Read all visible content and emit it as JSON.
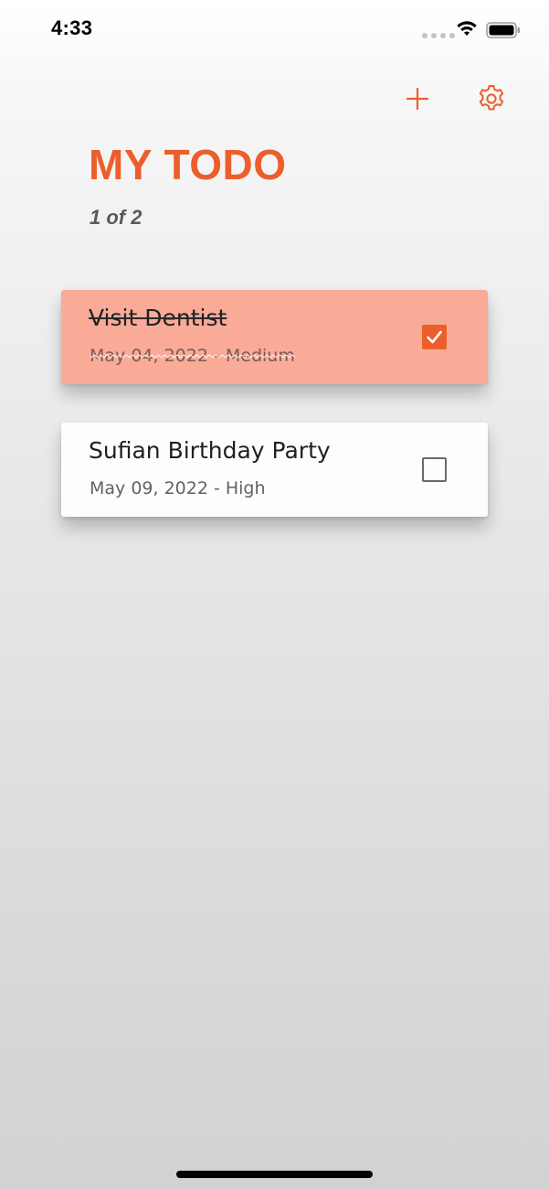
{
  "status_bar": {
    "time": "4:33"
  },
  "header": {
    "add_icon": "plus-icon",
    "settings_icon": "gear-icon",
    "title": "MY TODO",
    "counter": "1 of 2"
  },
  "todos": [
    {
      "title": "Visit Dentist",
      "meta": "May 04, 2022 - Medium",
      "completed": true
    },
    {
      "title": "Sufian Birthday Party",
      "meta": "May 09, 2022 - High",
      "completed": false
    }
  ],
  "colors": {
    "accent": "#ec5e2b",
    "completed_card": "#f9ab98",
    "open_card": "#fdfdfd"
  }
}
